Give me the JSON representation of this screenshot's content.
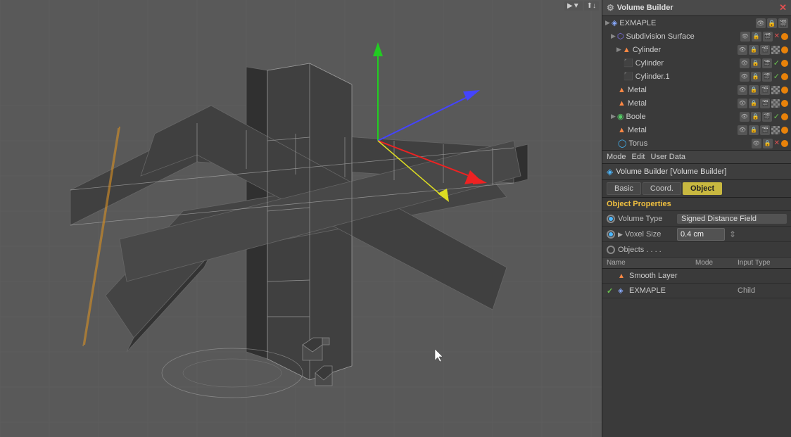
{
  "viewport": {
    "background_color": "#595959",
    "grid_color": "#666",
    "header_buttons": [
      "▶▼",
      "⬆↓"
    ]
  },
  "scene_hierarchy": {
    "title": "Volume Builder",
    "items": [
      {
        "id": "exmaple",
        "label": "EXMAPLE",
        "indent": 1,
        "icon": "vol",
        "icons_right": [
          "vis",
          "lock",
          "render"
        ]
      },
      {
        "id": "subd",
        "label": "Subdivision Surface",
        "indent": 2,
        "icon": "subd",
        "status": "orange",
        "icons_right": [
          "vis",
          "lock",
          "render",
          "x",
          "orange"
        ]
      },
      {
        "id": "cylinder_grp",
        "label": "Cylinder",
        "indent": 3,
        "icon": "cyl",
        "icons_right": [
          "vis",
          "lock",
          "render",
          "checker",
          "orange"
        ]
      },
      {
        "id": "cylinder1",
        "label": "Cylinder",
        "indent": 4,
        "icon": "cyl_blue",
        "icons_right": [
          "vis",
          "lock",
          "render",
          "check",
          "orange"
        ]
      },
      {
        "id": "cylinder2",
        "label": "Cylinder.1",
        "indent": 4,
        "icon": "cyl_blue",
        "icons_right": [
          "vis",
          "lock",
          "render",
          "check",
          "orange"
        ]
      },
      {
        "id": "metal1",
        "label": "Metal",
        "indent": 3,
        "icon": "metal",
        "icons_right": [
          "vis",
          "lock",
          "render",
          "checker",
          "orange"
        ]
      },
      {
        "id": "metal2",
        "label": "Metal",
        "indent": 3,
        "icon": "metal",
        "icons_right": [
          "vis",
          "lock",
          "render",
          "checker",
          "orange"
        ]
      },
      {
        "id": "boole",
        "label": "Boole",
        "indent": 2,
        "icon": "boole",
        "icons_right": [
          "vis",
          "lock",
          "render",
          "check",
          "orange"
        ]
      },
      {
        "id": "metal3",
        "label": "Metal",
        "indent": 3,
        "icon": "metal",
        "icons_right": [
          "vis",
          "lock",
          "render",
          "checker",
          "orange"
        ]
      },
      {
        "id": "torus",
        "label": "Torus",
        "indent": 3,
        "icon": "torus",
        "icons_right": [
          "vis",
          "lock",
          "x",
          "orange"
        ]
      }
    ]
  },
  "properties": {
    "toolbar": {
      "mode_label": "Mode",
      "edit_label": "Edit",
      "user_data_label": "User Data"
    },
    "title": "Volume Builder [Volume Builder]",
    "tabs": [
      {
        "id": "basic",
        "label": "Basic",
        "active": false
      },
      {
        "id": "coord",
        "label": "Coord.",
        "active": false
      },
      {
        "id": "object",
        "label": "Object",
        "active": true
      }
    ],
    "section_title": "Object Properties",
    "volume_type_label": "Volume Type",
    "volume_type_value": "Signed Distance Field",
    "voxel_size_label": "Voxel Size",
    "voxel_size_value": "0.4 cm",
    "objects_label": "Objects . . . .",
    "table": {
      "headers": {
        "name": "Name",
        "mode": "Mode",
        "input_type": "Input Type"
      },
      "rows": [
        {
          "check": "",
          "icon": "smooth",
          "name": "Smooth Layer",
          "mode": "",
          "input_type": ""
        },
        {
          "check": "✓",
          "icon": "vol",
          "name": "EXMAPLE",
          "mode": "",
          "input_type": "Child"
        }
      ]
    }
  }
}
